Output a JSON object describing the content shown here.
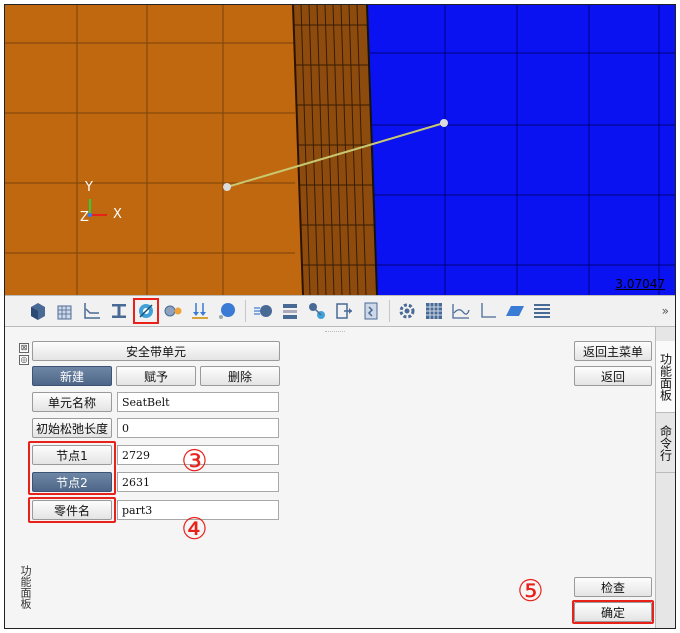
{
  "viewport": {
    "axes": {
      "y": "Y",
      "z": "Z",
      "x": "X"
    },
    "scale_readout": "3.07047"
  },
  "toolbar": {
    "icons": [
      "cube-icon",
      "grid-cube-icon",
      "line-chart-icon",
      "beam-icon",
      "seatbelt-icon",
      "gears-icon",
      "arrows-down-icon",
      "sphere-icon",
      "sheet-icon",
      "stack-icon",
      "nodes-icon",
      "export-icon",
      "doc-icon",
      "settings-icon",
      "mesh-icon",
      "curve-icon",
      "axis-icon",
      "plane-icon",
      "lines-icon"
    ],
    "more": "»",
    "highlighted": "seatbelt-icon"
  },
  "panel": {
    "title": "安全带单元",
    "buttons": {
      "new": "新建",
      "assign": "赋予",
      "delete": "删除",
      "back_main": "返回主菜单",
      "back": "返回",
      "check": "检查",
      "confirm": "确定"
    },
    "fields": [
      {
        "label": "单元名称",
        "value": "SeatBelt"
      },
      {
        "label": "初始松弛长度",
        "value": "0"
      },
      {
        "label": "节点1",
        "value": "2729"
      },
      {
        "label": "节点2",
        "value": "2631"
      },
      {
        "label": "零件名",
        "value": "part3"
      }
    ],
    "vertical_caption": "功能面板",
    "mini_icons": [
      "⊠",
      "◎"
    ]
  },
  "side_tabs": [
    "功能面板",
    "命令行"
  ],
  "callouts": {
    "c3": "③",
    "c4": "④",
    "c5": "⑤"
  },
  "colors": {
    "orange": "#c0680f",
    "blue": "#0a12f2",
    "highlight": "#e8221b",
    "button_dark": "#5a7395"
  }
}
